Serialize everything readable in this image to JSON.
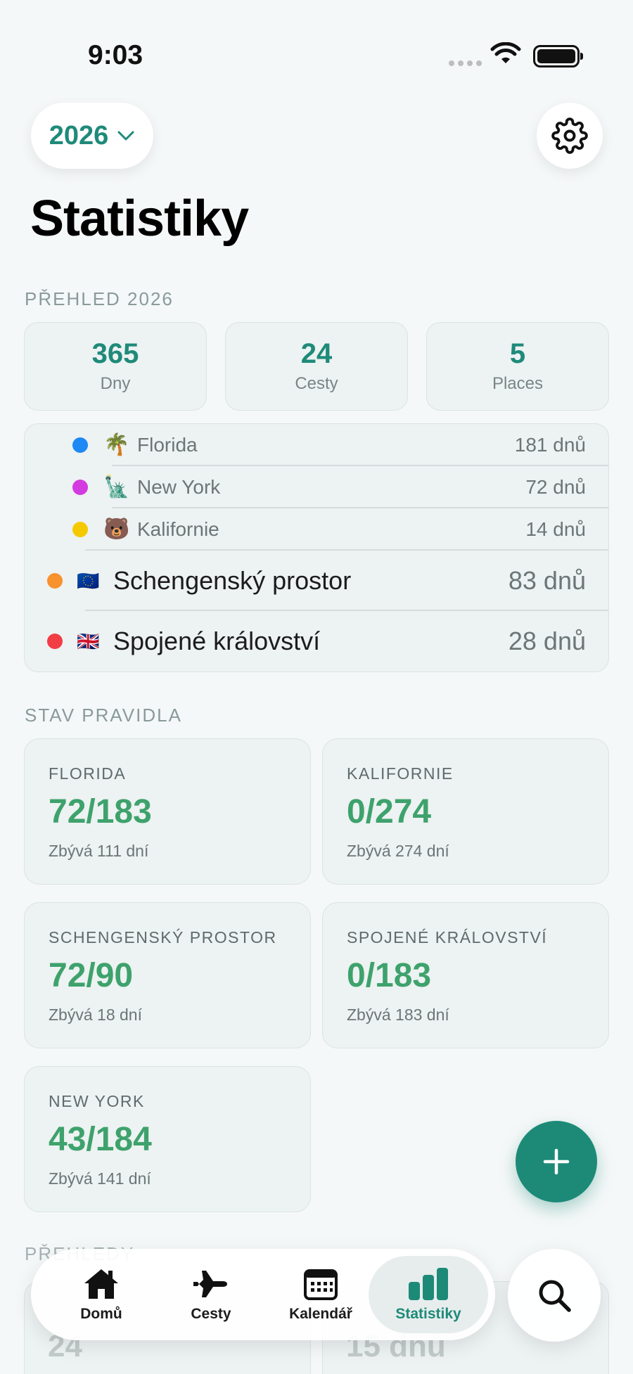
{
  "status_bar": {
    "time": "9:03"
  },
  "header": {
    "year": "2026",
    "title": "Statistiky"
  },
  "overview": {
    "label": "PŘEHLED 2026",
    "stats": [
      {
        "value": "365",
        "label": "Dny"
      },
      {
        "value": "24",
        "label": "Cesty"
      },
      {
        "value": "5",
        "label": "Places"
      }
    ],
    "places": [
      {
        "name": "Florida",
        "value": "181 dnů",
        "emoji": "🌴",
        "color": "#1e88f5",
        "size": "small"
      },
      {
        "name": "New York",
        "value": "72 dnů",
        "emoji": "🗽",
        "color": "#d33be0",
        "size": "small"
      },
      {
        "name": "Kalifornie",
        "value": "14 dnů",
        "emoji": "🐻",
        "color": "#f5c900",
        "size": "small"
      },
      {
        "name": "Schengenský prostor",
        "value": "83 dnů",
        "emoji": "🇪🇺",
        "color": "#f7922e",
        "size": "big"
      },
      {
        "name": "Spojené království",
        "value": "28 dnů",
        "emoji": "🇬🇧",
        "color": "#f23d44",
        "size": "big"
      }
    ]
  },
  "rules": {
    "label": "STAV PRAVIDLA",
    "items": [
      {
        "name": "FLORIDA",
        "value": "72/183",
        "remaining": "Zbývá 111 dní"
      },
      {
        "name": "KALIFORNIE",
        "value": "0/274",
        "remaining": "Zbývá 274 dní"
      },
      {
        "name": "SCHENGENSKÝ PROSTOR",
        "value": "72/90",
        "remaining": "Zbývá 18 dní"
      },
      {
        "name": "SPOJENÉ KRÁLOVSTVÍ",
        "value": "0/183",
        "remaining": "Zbývá 183 dní"
      },
      {
        "name": "NEW YORK",
        "value": "43/184",
        "remaining": "Zbývá 141 dní"
      }
    ]
  },
  "peek": {
    "label": "PŘEHLEDY",
    "values": [
      "24",
      "15 dnů"
    ]
  },
  "tabs": [
    {
      "label": "Domů",
      "icon": "home-icon"
    },
    {
      "label": "Cesty",
      "icon": "plane-icon"
    },
    {
      "label": "Kalendář",
      "icon": "calendar-icon"
    },
    {
      "label": "Statistiky",
      "icon": "chart-icon",
      "active": true
    }
  ],
  "colors": {
    "accent": "#1d8a78",
    "rule_value": "#3ea26c"
  }
}
